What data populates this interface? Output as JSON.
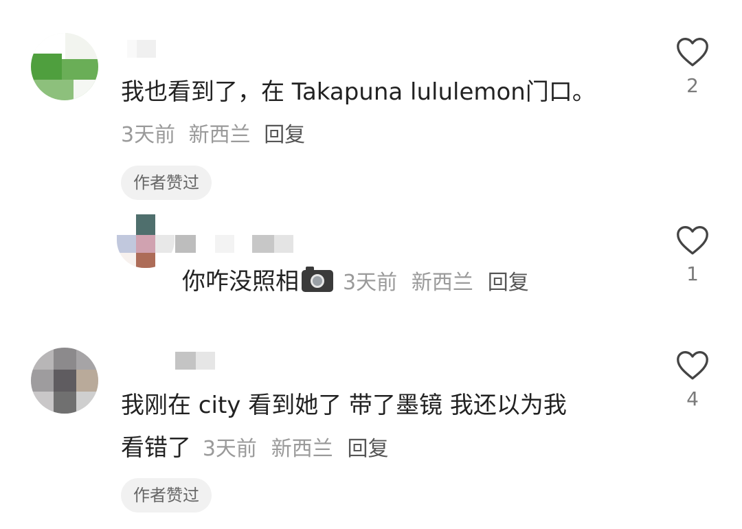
{
  "comments": [
    {
      "text": "我也看到了，在 Takapuna lululemon门口。",
      "time": "3天前",
      "location": "新西兰",
      "reply_label": "回复",
      "badge": "作者赞过",
      "like_count": "2"
    },
    {
      "text": "你咋没照相",
      "emoji_icon": "camera-icon",
      "time": "3天前",
      "location": "新西兰",
      "reply_label": "回复",
      "like_count": "1"
    },
    {
      "text_line1": "我刚在 city 看到她了 带了墨镜 我还以为我",
      "text_line2": "看错了",
      "time": "3天前",
      "location": "新西兰",
      "reply_label": "回复",
      "badge": "作者赞过",
      "like_count": "4"
    }
  ],
  "colors": {
    "text": "#222222",
    "meta": "#9a9a9a",
    "badge_bg": "#f1f1f1",
    "heart_stroke": "#444444"
  }
}
